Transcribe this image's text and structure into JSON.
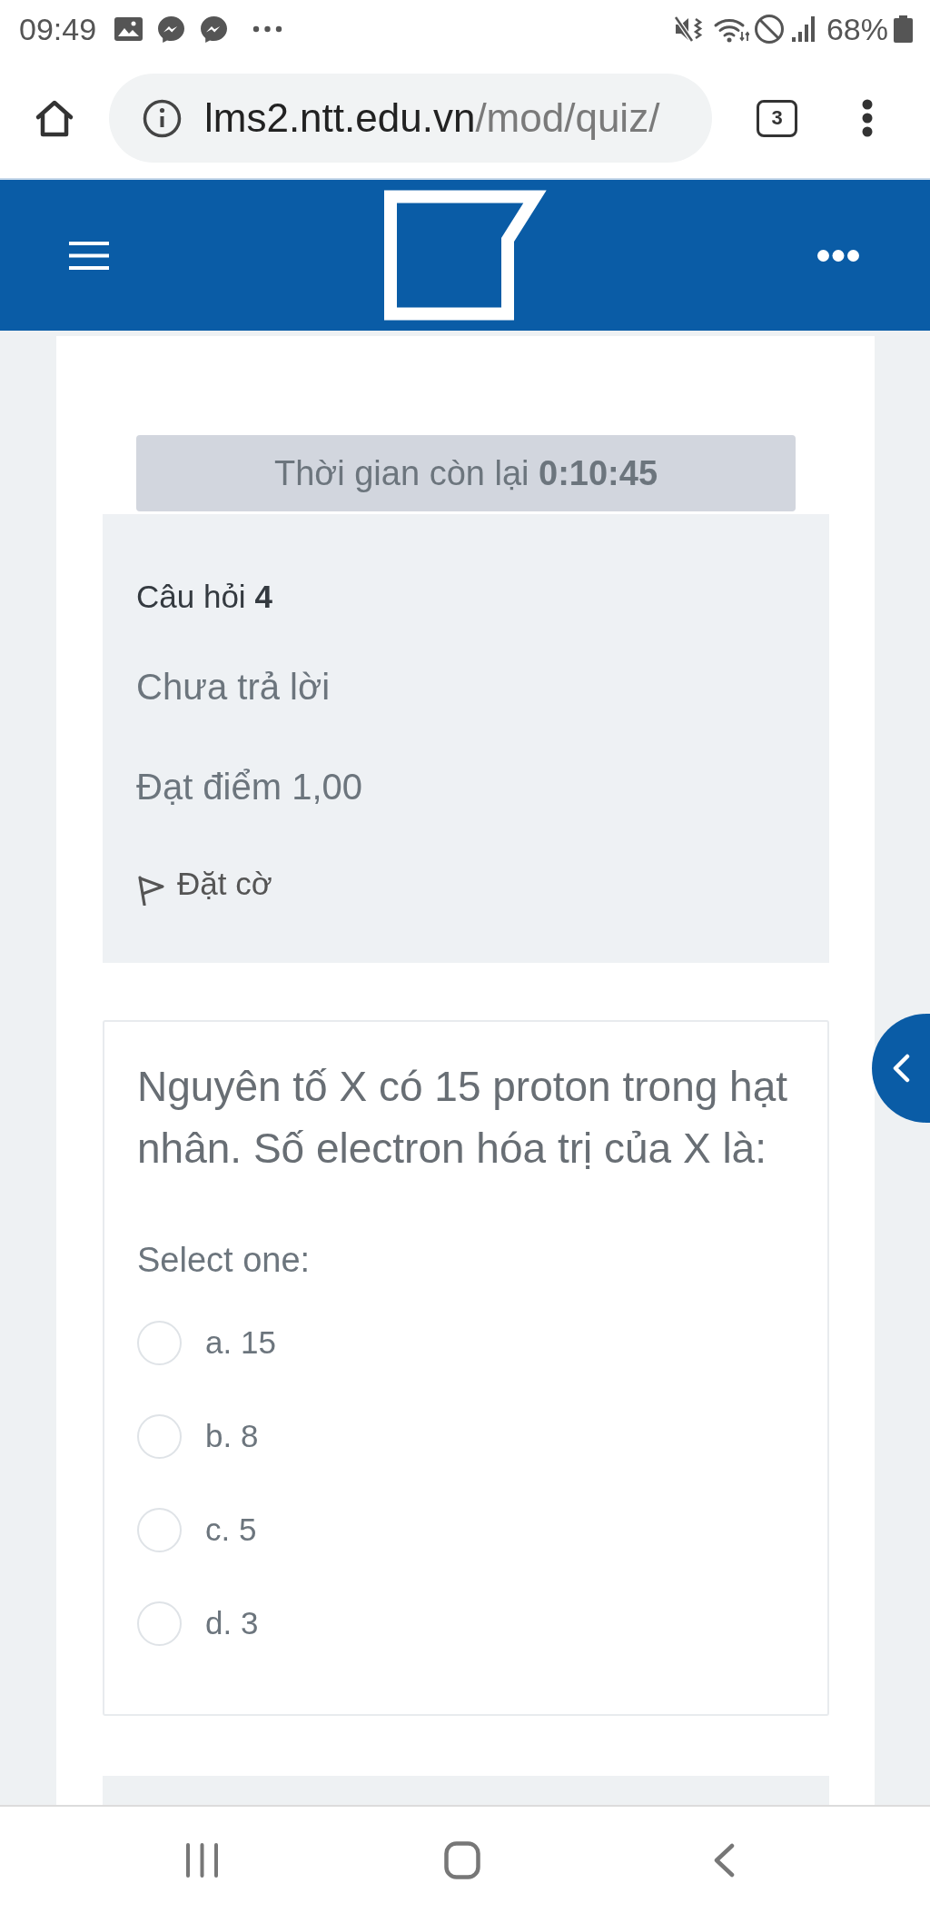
{
  "status_bar": {
    "time": "09:49",
    "battery": "68%"
  },
  "browser": {
    "url_host": "lms2.ntt.edu.vn",
    "url_path": "/mod/quiz/",
    "tab_count": "3"
  },
  "timer": {
    "text": "Thời gian còn lại **0:10:45**"
  },
  "question_info": {
    "heading": "Câu hỏi **4**",
    "status": "Chưa trả lời",
    "mark": "Đạt điểm 1,00",
    "flag_label": "Đặt cờ"
  },
  "question": {
    "text": "Nguyên tố X có 15 proton trong hạt nhân. Số electron hóa trị của X là:",
    "prompt": "Select one:",
    "options": [
      {
        "label": "a. 15",
        "selected": false
      },
      {
        "label": "b. 8",
        "selected": false
      },
      {
        "label": "c. 5",
        "selected": false
      },
      {
        "label": "d. 3",
        "selected": false
      }
    ]
  }
}
